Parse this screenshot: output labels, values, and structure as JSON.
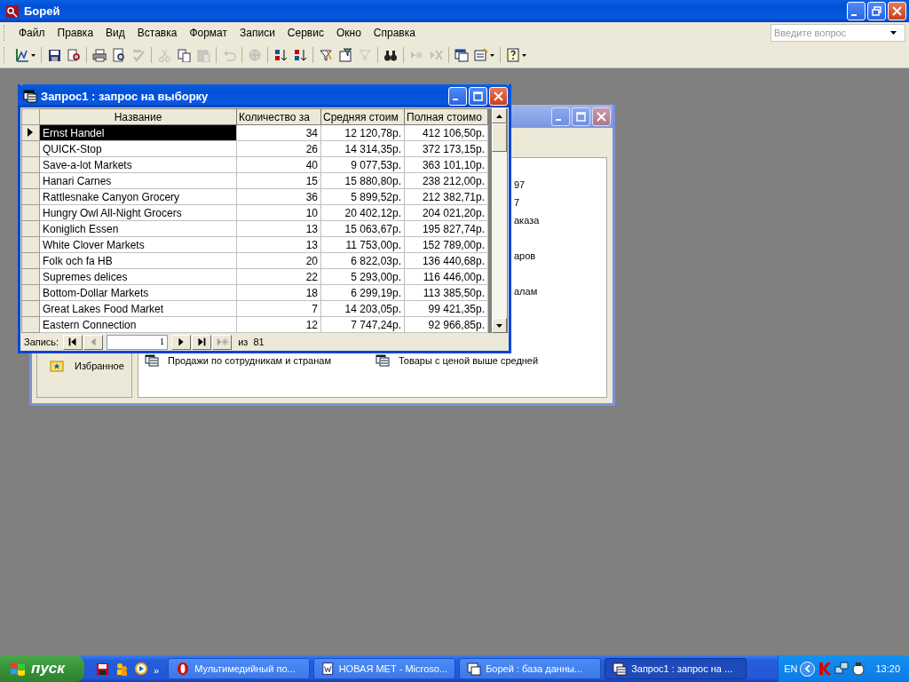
{
  "app_window": {
    "title": "Борей"
  },
  "menu": [
    {
      "label": "Файл"
    },
    {
      "label": "Правка"
    },
    {
      "label": "Вид"
    },
    {
      "label": "Вставка"
    },
    {
      "label": "Формат"
    },
    {
      "label": "Записи"
    },
    {
      "label": "Сервис"
    },
    {
      "label": "Окно"
    },
    {
      "label": "Справка"
    }
  ],
  "help_box": {
    "placeholder": "Введите вопрос"
  },
  "toolbar": [
    {
      "kind": "design",
      "disabled": false,
      "dropdown": true
    },
    {
      "kind": "sep"
    },
    {
      "kind": "save",
      "disabled": false
    },
    {
      "kind": "search",
      "disabled": false
    },
    {
      "kind": "sep"
    },
    {
      "kind": "print",
      "disabled": false
    },
    {
      "kind": "preview",
      "disabled": false
    },
    {
      "kind": "spell",
      "disabled": true
    },
    {
      "kind": "sep"
    },
    {
      "kind": "cut",
      "disabled": true
    },
    {
      "kind": "copy",
      "disabled": false
    },
    {
      "kind": "paste",
      "disabled": true
    },
    {
      "kind": "sep"
    },
    {
      "kind": "undo",
      "disabled": true
    },
    {
      "kind": "sep"
    },
    {
      "kind": "globe",
      "disabled": true
    },
    {
      "kind": "sep"
    },
    {
      "kind": "sortup",
      "disabled": false
    },
    {
      "kind": "sortdown",
      "disabled": false
    },
    {
      "kind": "sep"
    },
    {
      "kind": "filter",
      "disabled": false
    },
    {
      "kind": "form",
      "disabled": false
    },
    {
      "kind": "funnel",
      "disabled": true
    },
    {
      "kind": "sep"
    },
    {
      "kind": "find",
      "disabled": false
    },
    {
      "kind": "sep"
    },
    {
      "kind": "newrec",
      "disabled": true
    },
    {
      "kind": "delrec",
      "disabled": true
    },
    {
      "kind": "sep"
    },
    {
      "kind": "dbwin",
      "disabled": false
    },
    {
      "kind": "newobj",
      "disabled": false,
      "dropdown": true
    },
    {
      "kind": "sep"
    },
    {
      "kind": "help",
      "disabled": false,
      "dropdown": true
    }
  ],
  "database_window": {
    "partial_items": [
      "97",
      "7",
      "аказа",
      "аров",
      "алам"
    ],
    "groups": [
      {
        "label": "Избранное"
      }
    ],
    "objects": [
      {
        "label": "Продажи по сотрудникам и странам"
      },
      {
        "label": "Товары с ценой выше средней"
      }
    ]
  },
  "query_window": {
    "title": "Запрос1 : запрос на выборку",
    "columns": [
      "Название",
      "Количество за",
      "Средняя стоим",
      "Полная стоимо"
    ],
    "rows": [
      {
        "selected": true,
        "cells": [
          "Ernst Handel",
          "34",
          "12 120,78р.",
          "412 106,50р."
        ]
      },
      {
        "selected": false,
        "cells": [
          "QUICK-Stop",
          "26",
          "14 314,35р.",
          "372 173,15р."
        ]
      },
      {
        "selected": false,
        "cells": [
          "Save-a-lot Markets",
          "40",
          "9 077,53р.",
          "363 101,10р."
        ]
      },
      {
        "selected": false,
        "cells": [
          "Hanari Carnes",
          "15",
          "15 880,80р.",
          "238 212,00р."
        ]
      },
      {
        "selected": false,
        "cells": [
          "Rattlesnake Canyon Grocery",
          "36",
          "5 899,52р.",
          "212 382,71р."
        ]
      },
      {
        "selected": false,
        "cells": [
          "Hungry Owl All-Night Grocers",
          "10",
          "20 402,12р.",
          "204 021,20р."
        ]
      },
      {
        "selected": false,
        "cells": [
          "Koniglich Essen",
          "13",
          "15 063,67р.",
          "195 827,74р."
        ]
      },
      {
        "selected": false,
        "cells": [
          "White Clover Markets",
          "13",
          "11 753,00р.",
          "152 789,00р."
        ]
      },
      {
        "selected": false,
        "cells": [
          "Folk och fa HB",
          "20",
          "6 822,03р.",
          "136 440,68р."
        ]
      },
      {
        "selected": false,
        "cells": [
          "Supremes delices",
          "22",
          "5 293,00р.",
          "116 446,00р."
        ]
      },
      {
        "selected": false,
        "cells": [
          "Bottom-Dollar Markets",
          "18",
          "6 299,19р.",
          "113 385,50р."
        ]
      },
      {
        "selected": false,
        "cells": [
          "Great Lakes Food Market",
          "7",
          "14 203,05р.",
          "99 421,35р."
        ]
      },
      {
        "selected": false,
        "cells": [
          "Eastern Connection",
          "12",
          "7 747,24р.",
          "92 966,85р."
        ]
      }
    ],
    "navigator": {
      "label": "Запись:",
      "record": "1",
      "total": "из  81",
      "buttons": [
        {
          "kind": "first",
          "disabled": false
        },
        {
          "kind": "prev",
          "disabled": true
        },
        {
          "kind": "field"
        },
        {
          "kind": "next",
          "disabled": false
        },
        {
          "kind": "last",
          "disabled": false
        },
        {
          "kind": "new",
          "disabled": true
        }
      ]
    }
  },
  "taskbar": {
    "start": "пуск",
    "quick_launch": [
      {
        "kind": "disk"
      },
      {
        "kind": "people"
      },
      {
        "kind": "player"
      }
    ],
    "more": "»",
    "tasks": [
      {
        "label": "Мультимедийный по...",
        "kind": "opera",
        "selected": false
      },
      {
        "label": "НОВАЯ МЕТ - Microso...",
        "kind": "word",
        "selected": false
      },
      {
        "label": "Борей : база данны...",
        "kind": "db",
        "selected": false
      },
      {
        "label": "Запрос1 : запрос на ...",
        "kind": "query",
        "selected": true
      }
    ],
    "language": "EN",
    "clock": "13:20"
  }
}
